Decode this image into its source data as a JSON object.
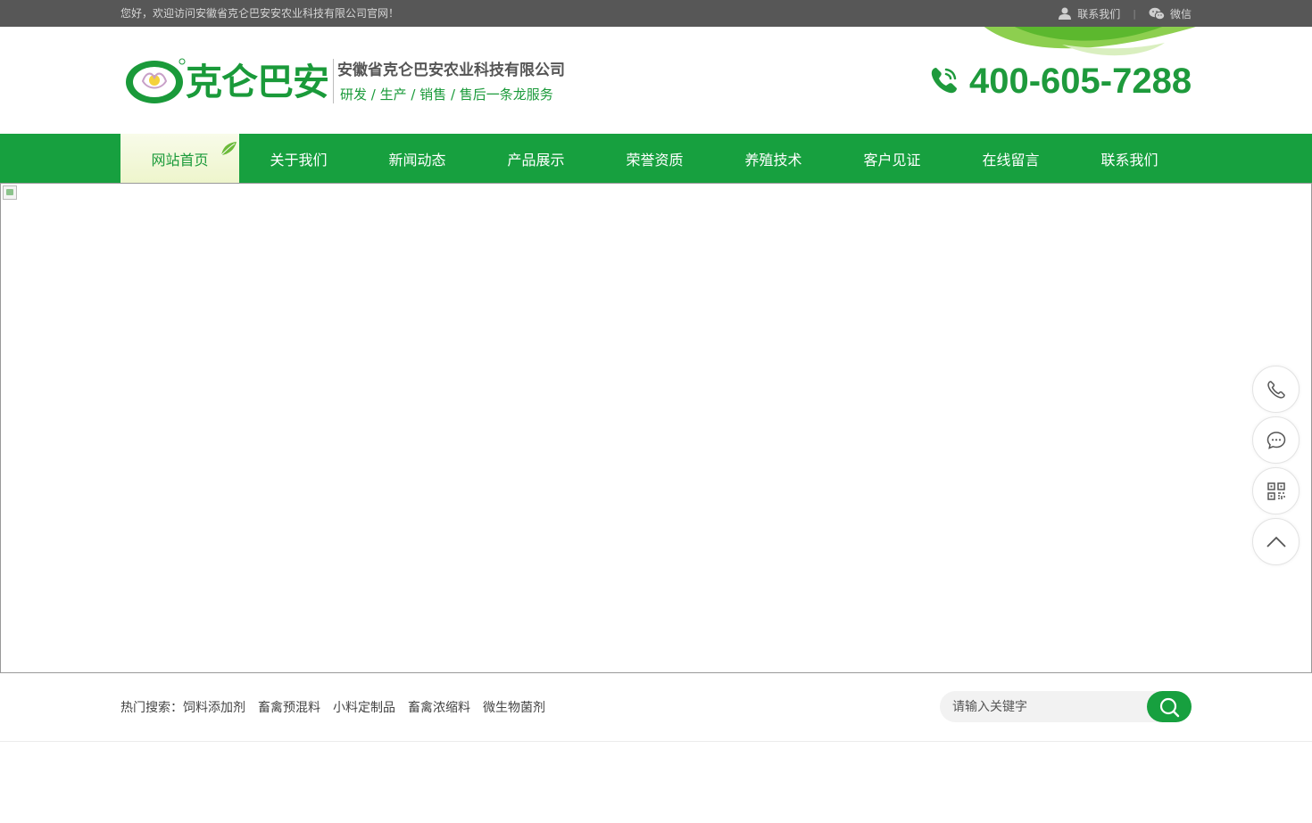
{
  "topbar": {
    "welcome": "您好，欢迎访问安徽省克仑巴安安农业科技有限公司官网！",
    "contact_label": "联系我们",
    "separator": "|",
    "wechat_label": "微信"
  },
  "header": {
    "logo_text": "克仑巴安",
    "company_name": "安徽省克仑巴安农业科技有限公司",
    "slogan": "研发 / 生产 / 销售 / 售后一条龙服务",
    "phone": "400-605-7288"
  },
  "nav": {
    "items": [
      {
        "label": "网站首页",
        "active": true
      },
      {
        "label": "关于我们"
      },
      {
        "label": "新闻动态"
      },
      {
        "label": "产品展示"
      },
      {
        "label": "荣誉资质"
      },
      {
        "label": "养殖技术"
      },
      {
        "label": "客户见证"
      },
      {
        "label": "在线留言"
      },
      {
        "label": "联系我们"
      }
    ]
  },
  "float_tools": [
    {
      "icon": "phone-icon"
    },
    {
      "icon": "message-icon"
    },
    {
      "icon": "qrcode-icon"
    },
    {
      "icon": "chevron-up-icon"
    }
  ],
  "hot_search": {
    "label": "热门搜索：",
    "keywords": [
      "饲料添加剂",
      "畜禽预混料",
      "小料定制品",
      "畜禽浓缩料",
      "微生物菌剂"
    ],
    "placeholder": "请输入关键字"
  },
  "colors": {
    "brand_green": "#17a03f",
    "topbar_bg": "#575757",
    "nav_active_bg": "#f3f8dc"
  }
}
